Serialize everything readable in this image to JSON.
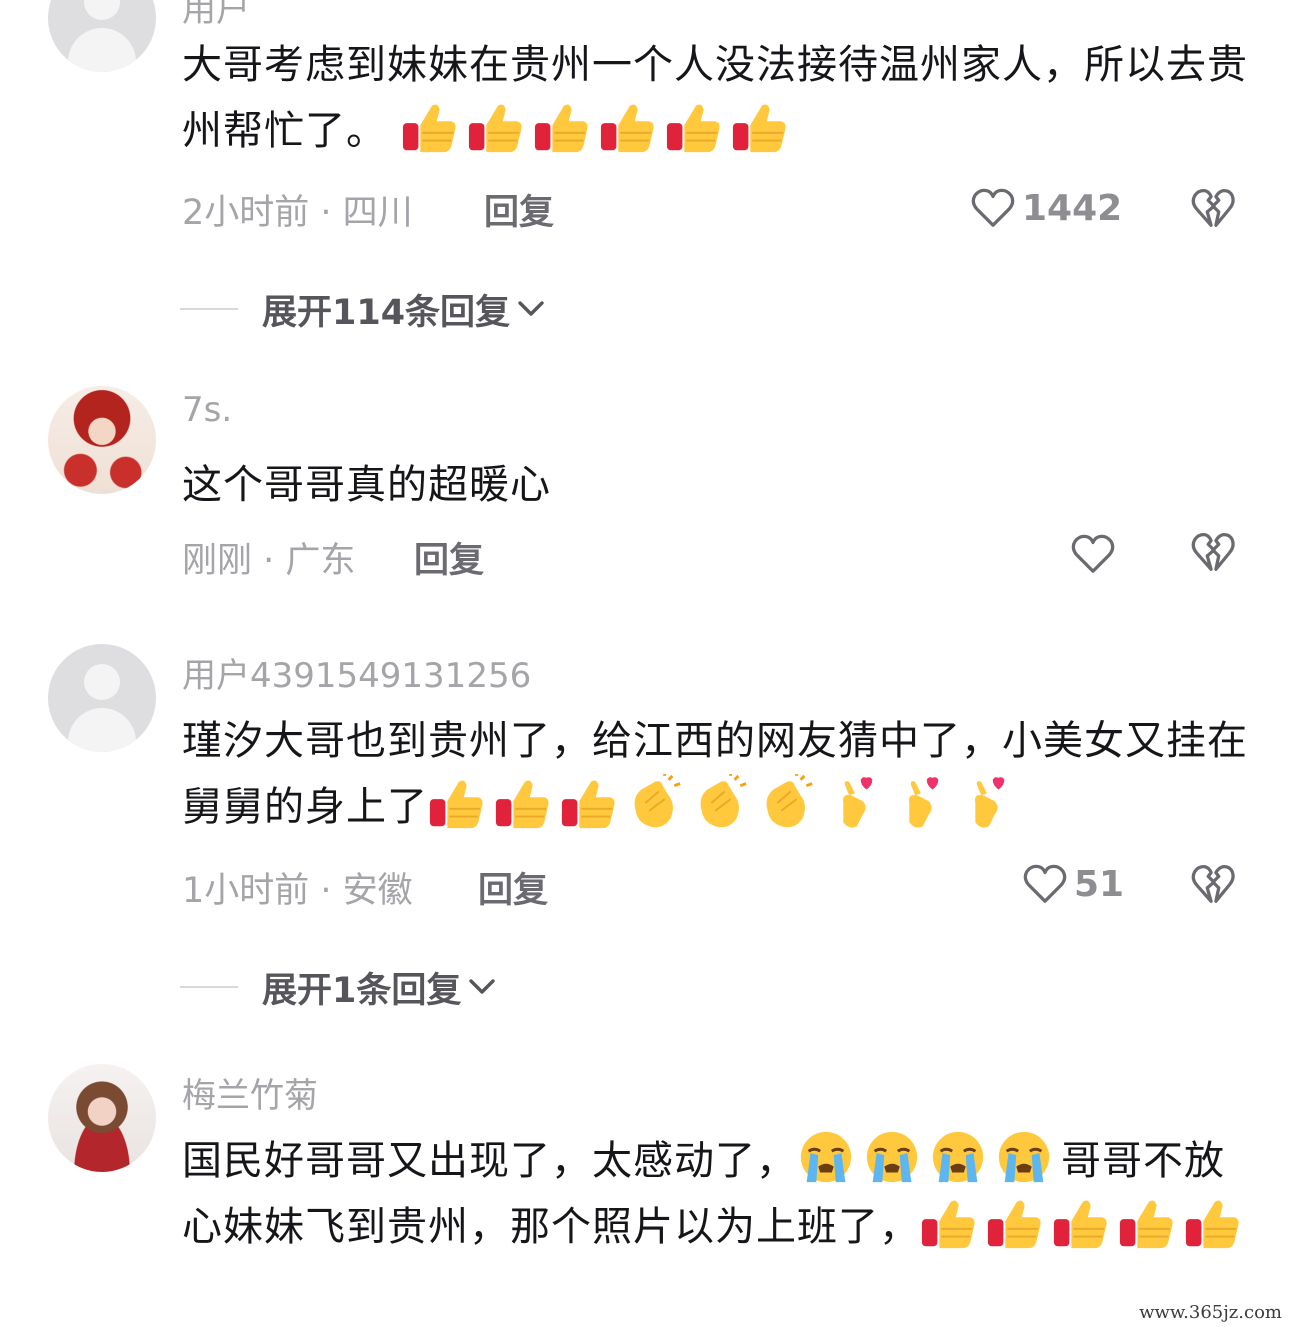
{
  "comments": [
    {
      "username": "用户",
      "text": "大哥考虑到妹妹在贵州一个人没法接待温州家人，所以去贵州帮忙了。",
      "emojis": [
        "thumbs-up-emoji",
        "thumbs-up-emoji",
        "thumbs-up-emoji",
        "thumbs-up-emoji",
        "thumbs-up-emoji",
        "thumbs-up-emoji"
      ],
      "time_location": "2小时前 · 四川",
      "reply_label": "回复",
      "like_count": "1442",
      "expand_label": "展开114条回复"
    },
    {
      "username": "7s.",
      "text": "这个哥哥真的超暖心",
      "time_location": "刚刚 · 广东",
      "reply_label": "回复",
      "like_count": ""
    },
    {
      "username": "用户4391549131256",
      "text": "瑾汐大哥也到贵州了，给江西的网友猜中了，小美女又挂在舅舅的身上了",
      "emojis": [
        "thumbs-up-emoji",
        "thumbs-up-emoji",
        "thumbs-up-emoji",
        "clapping-hands-emoji",
        "clapping-hands-emoji",
        "clapping-hands-emoji",
        "finger-heart-emoji",
        "finger-heart-emoji",
        "finger-heart-emoji"
      ],
      "time_location": "1小时前 · 安徽",
      "reply_label": "回复",
      "like_count": "51",
      "expand_label": "展开1条回复"
    },
    {
      "username": "梅兰竹菊",
      "text_part1": "国民好哥哥又出现了，太感动了，",
      "emojis_mid": [
        "crying-face-emoji",
        "crying-face-emoji",
        "crying-face-emoji",
        "crying-face-emoji"
      ],
      "text_part2": "哥哥不放心妹妹飞到贵州，那个照片以为上班了，",
      "emojis": [
        "thumbs-up-emoji",
        "thumbs-up-emoji",
        "thumbs-up-emoji",
        "thumbs-up-emoji",
        "thumbs-up-emoji"
      ]
    }
  ],
  "icons": {
    "like": "heart-outline-icon",
    "dislike": "broken-heart-icon",
    "expand": "chevron-down-icon"
  },
  "watermark": "www.365jz.com"
}
